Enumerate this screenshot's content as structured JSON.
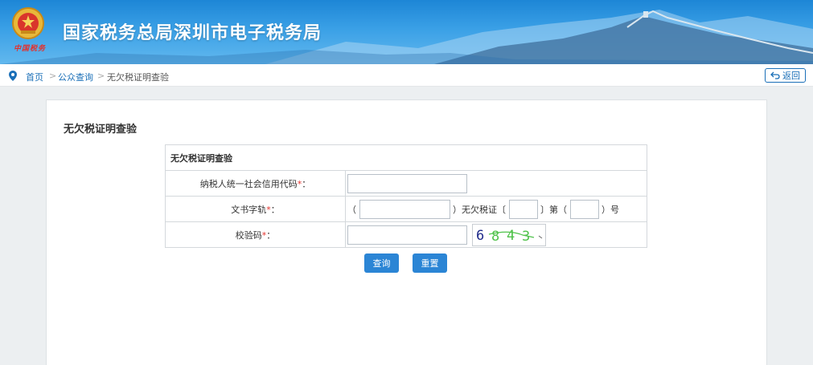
{
  "header": {
    "title": "国家税务总局深圳市电子税务局",
    "emblem_caption": "中国税务",
    "emblem_icon": "tax-emblem-icon"
  },
  "breadcrumb": {
    "home": "首页",
    "separator": ">",
    "public_query": "公众查询",
    "current": "无欠税证明查验"
  },
  "back_button": {
    "label": "返回",
    "icon": "return-arrow-icon"
  },
  "panel": {
    "title": "无欠税证明查验"
  },
  "form": {
    "caption": "无欠税证明查验",
    "taxpayer_code_label": "纳税人统一社会信用代码",
    "doc_no_label": "文书字轨",
    "verify_code_label": "校验码",
    "required_mark": "*",
    "colon": "：",
    "open_paren": "（",
    "close_paren_cert": "）无欠税证〔",
    "di": "〕第（",
    "hao": "）号",
    "taxpayer_code_value": "",
    "doc_no_part1": "",
    "doc_no_year": "",
    "doc_no_number": "",
    "verify_code_value": "",
    "captcha_text": "6843"
  },
  "buttons": {
    "query": "查询",
    "reset": "重置"
  },
  "colors": {
    "accent": "#2b85d5",
    "link": "#1a6fb8",
    "required": "#e4302b",
    "header": "#1d86d6"
  }
}
